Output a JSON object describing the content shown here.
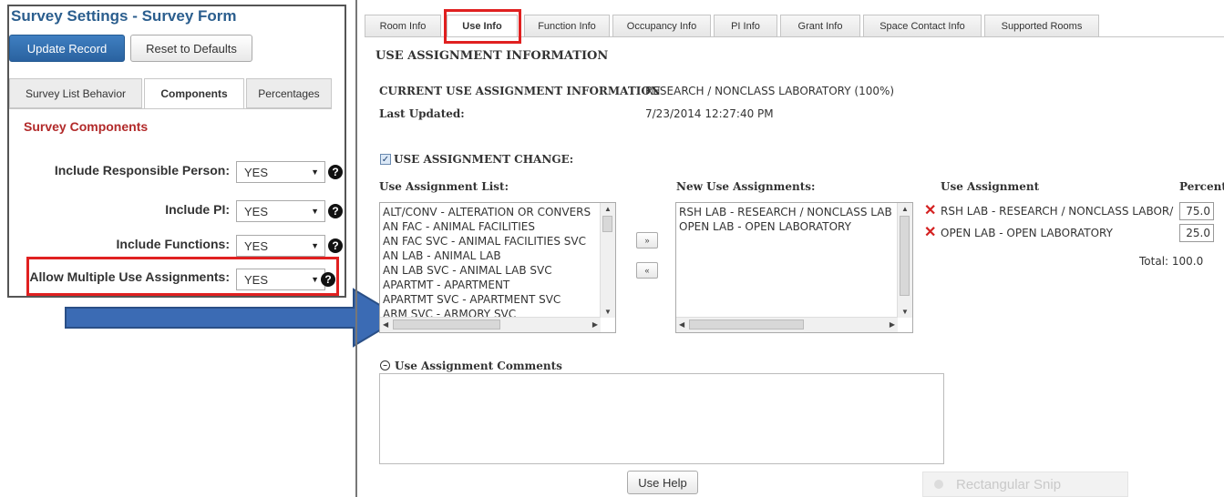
{
  "left": {
    "title": "Survey Settings - Survey Form",
    "update_button": "Update Record",
    "reset_button": "Reset to Defaults",
    "tabs": [
      {
        "label": "Survey List Behavior"
      },
      {
        "label": "Components"
      },
      {
        "label": "Percentages"
      }
    ],
    "section_title": "Survey Components",
    "rows": [
      {
        "label": "Include Responsible Person:",
        "value": "YES"
      },
      {
        "label": "Include PI:",
        "value": "YES"
      },
      {
        "label": "Include Functions:",
        "value": "YES"
      },
      {
        "label": "Allow Multiple Use Assignments:",
        "value": "YES"
      }
    ]
  },
  "right": {
    "tabs": [
      {
        "label": "Room Info"
      },
      {
        "label": "Use Info"
      },
      {
        "label": "Function Info"
      },
      {
        "label": "Occupancy Info"
      },
      {
        "label": "PI Info"
      },
      {
        "label": "Grant Info"
      },
      {
        "label": "Space Contact Info"
      },
      {
        "label": "Supported Rooms"
      }
    ],
    "heading": "USE ASSIGNMENT INFORMATION",
    "current_label": "CURRENT USE ASSIGNMENT INFORMATION",
    "current_value": "RESEARCH / NONCLASS LABORATORY (100%)",
    "last_updated_label": "Last Updated:",
    "last_updated_value": "7/23/2014 12:27:40 PM",
    "change_label": "USE ASSIGNMENT CHANGE:",
    "list_header": "Use Assignment List:",
    "new_header": "New Use Assignments:",
    "assign_header": "Use Assignment",
    "percent_header": "Percent",
    "list_items": [
      "ALT/CONV - ALTERATION OR CONVERS",
      "AN FAC - ANIMAL FACILITIES",
      "AN FAC SVC - ANIMAL FACILITIES SVC",
      "AN LAB - ANIMAL LAB",
      "AN LAB SVC - ANIMAL LAB SVC",
      "APARTMT - APARTMENT",
      "APARTMT SVC - APARTMENT SVC",
      "ARM SVC - ARMORY SVC"
    ],
    "new_items": [
      "RSH LAB - RESEARCH / NONCLASS LAB",
      "OPEN LAB - OPEN LABORATORY"
    ],
    "assignments": [
      {
        "name": "RSH LAB - RESEARCH / NONCLASS LABOR/",
        "percent": "75.0"
      },
      {
        "name": "OPEN LAB - OPEN LABORATORY",
        "percent": "25.0"
      }
    ],
    "total": "Total: 100.0",
    "comments_label": "Use Assignment Comments",
    "help_button": "Use Help",
    "add_arrow": "»",
    "remove_arrow": "«",
    "snip_text": "Rectangular Snip"
  },
  "colors": {
    "title_blue": "#2b5e8e",
    "button_blue": "#2a62a0",
    "section_red": "#b22a2a",
    "highlight_red": "#e02020",
    "arrow_blue": "#3b6bb4"
  }
}
